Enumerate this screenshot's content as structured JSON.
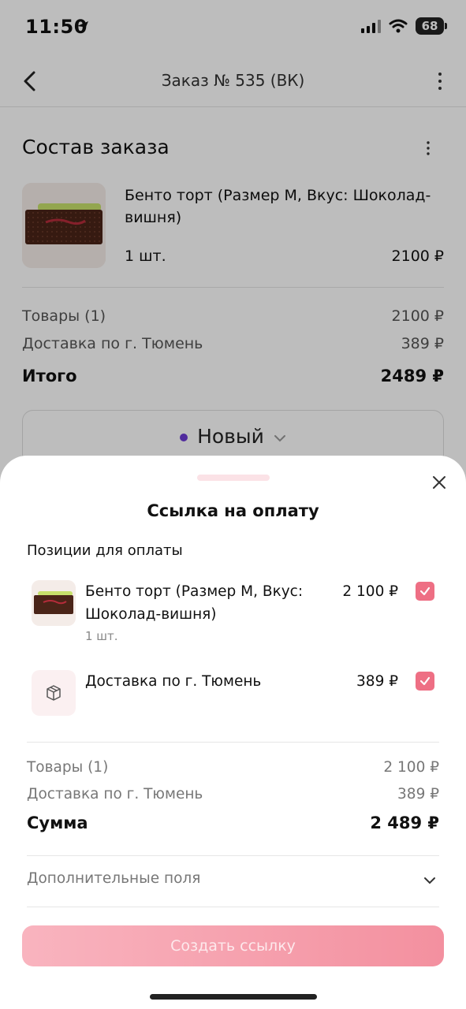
{
  "status_bar": {
    "time": "11:50",
    "battery": "68"
  },
  "nav": {
    "title": "Заказ № 535 (ВК)"
  },
  "order": {
    "section_title": "Состав заказа",
    "item": {
      "name": "Бенто торт (Размер M, Вкус: Шоколад-вишня)",
      "qty": "1 шт.",
      "price": "2100 ₽"
    },
    "summary": {
      "goods_label": "Товары (1)",
      "goods_value": "2100 ₽",
      "delivery_label": "Доставка по г. Тюмень",
      "delivery_value": "389 ₽",
      "total_label": "Итого",
      "total_value": "2489 ₽"
    },
    "status": {
      "label": "Новый",
      "color": "#6c3bd4"
    }
  },
  "sheet": {
    "title": "Ссылка на оплату",
    "positions_label": "Позиции для оплаты",
    "items": [
      {
        "name": "Бенто торт (Размер M, Вкус: Шоколад-вишня)",
        "qty": "1 шт.",
        "price": "2 100 ₽",
        "checked": true
      },
      {
        "name": "Доставка по г. Тюмень",
        "price": "389 ₽",
        "checked": true,
        "icon": "box-icon"
      }
    ],
    "summary": {
      "goods_label": "Товары (1)",
      "goods_value": "2 100 ₽",
      "delivery_label": "Доставка по г. Тюмень",
      "delivery_value": "389 ₽",
      "total_label": "Сумма",
      "total_value": "2 489 ₽"
    },
    "extra_fields_label": "Дополнительные поля",
    "create_button": "Создать ссылку",
    "accent_color": "#ee6f84"
  }
}
